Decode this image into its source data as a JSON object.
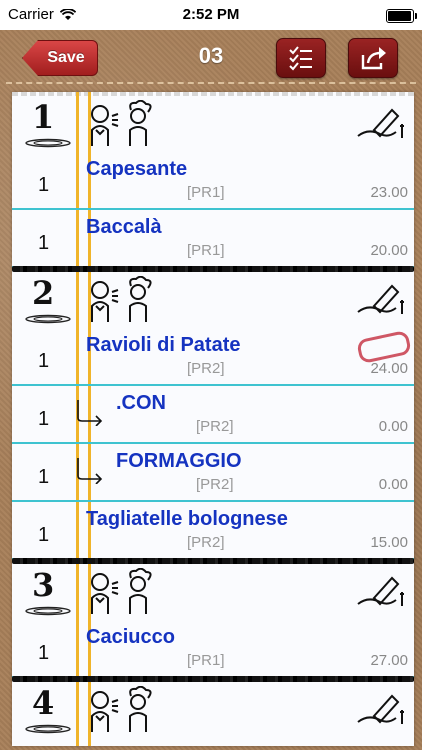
{
  "status_bar": {
    "carrier": "Carrier",
    "time": "2:52 PM",
    "battery_level": 0.95
  },
  "nav": {
    "save_label": "Save",
    "title": "03"
  },
  "sections": [
    {
      "course": "1",
      "items": [
        {
          "qty": "1",
          "name": "Capesante",
          "code": "[PR1]",
          "price": "23.00",
          "sub": false
        },
        {
          "qty": "1",
          "name": "Baccalà",
          "code": "[PR1]",
          "price": "20.00",
          "sub": false
        }
      ]
    },
    {
      "course": "2",
      "items": [
        {
          "qty": "1",
          "name": "Ravioli di Patate",
          "code": "[PR2]",
          "price": "24.00",
          "sub": false
        },
        {
          "qty": "1",
          "name": ".CON",
          "code": "[PR2]",
          "price": "0.00",
          "sub": true
        },
        {
          "qty": "1",
          "name": "FORMAGGIO",
          "code": "[PR2]",
          "price": "0.00",
          "sub": true
        },
        {
          "qty": "1",
          "name": "Tagliatelle bolognese",
          "code": "[PR2]",
          "price": "15.00",
          "sub": false
        }
      ]
    },
    {
      "course": "3",
      "items": [
        {
          "qty": "1",
          "name": "Caciucco",
          "code": "[PR1]",
          "price": "27.00",
          "sub": false
        }
      ]
    },
    {
      "course": "4",
      "items": []
    }
  ],
  "colors": {
    "item_name": "#1533c0",
    "row_line": "#3ec3d0",
    "margin_line": "#f0b42a",
    "save_button": "#c0302f"
  },
  "icons": [
    "wifi-icon",
    "battery-icon",
    "back-arrow-icon",
    "checklist-icon",
    "share-icon",
    "waiter-chef-icon",
    "edit-pencil-icon",
    "plate-icon",
    "sub-item-arrow-icon",
    "paperclip-icon"
  ]
}
